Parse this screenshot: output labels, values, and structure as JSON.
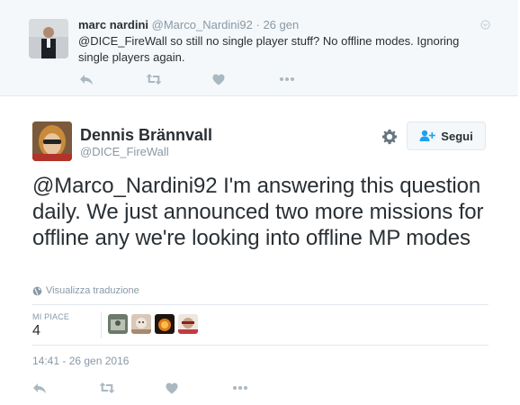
{
  "reply_tweet": {
    "name": "marc nardini",
    "handle": "@Marco_Nardini92",
    "separator": "·",
    "time": "26 gen",
    "text_mention": "@DICE_FireWall",
    "text_body": " so still no single player stuff? No offline modes. Ignoring single players again."
  },
  "main_tweet": {
    "name": "Dennis Brännvall",
    "handle": "@DICE_FireWall",
    "follow_label": "Segui",
    "text_mention": "@Marco_Nardini92",
    "text_body": " I'm answering this question daily. We just announced two more missions for offline any we're looking into offline MP modes",
    "translate_label": "Visualizza traduzione",
    "likes_label": "MI PIACE",
    "likes_count": "4",
    "timestamp": "14:41 - 26 gen 2016"
  },
  "colors": {
    "muted": "#8899a6",
    "text": "#292f33",
    "reply_bg": "#f5f8fa",
    "border": "#e1e8ed"
  },
  "icons": [
    "reply-icon",
    "retweet-icon",
    "like-icon",
    "more-icon",
    "gear-icon",
    "follow-person-icon",
    "globe-icon"
  ]
}
